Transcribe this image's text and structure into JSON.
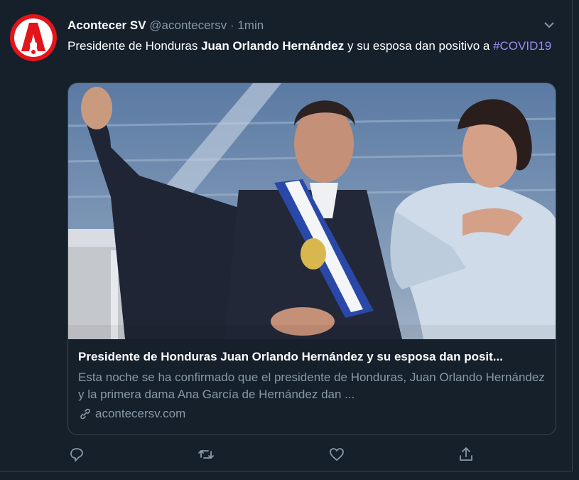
{
  "tweet": {
    "author_name": "Acontecer SV",
    "handle": "@acontecersv",
    "separator": "·",
    "time": "1min",
    "text_prefix": "Presidente de Honduras ",
    "text_bold": "Juan Orlando Hernández",
    "text_suffix": " y su esposa dan positivo a ",
    "hashtag": "#COVID19"
  },
  "card": {
    "title": "Presidente de Honduras Juan Orlando Hernández y su esposa dan posit...",
    "description": "Esta noche se ha confirmado que el presidente de Honduras, Juan Orlando Hernández y la primera dama Ana García de Hernández dan ...",
    "domain": "acontecersv.com"
  },
  "icons": {
    "avatar": "acontecer-logo",
    "menu": "chevron-down-icon",
    "reply": "reply-icon",
    "retweet": "retweet-icon",
    "like": "heart-icon",
    "share": "share-icon",
    "link": "link-icon"
  },
  "colors": {
    "background": "#15202b",
    "secondary_text": "#8899a6",
    "hashtag": "#9b8cf0",
    "logo_red": "#e3151a"
  }
}
